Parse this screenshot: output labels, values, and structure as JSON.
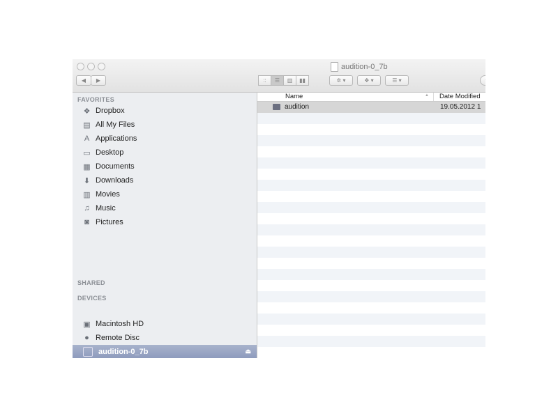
{
  "window": {
    "title": "audition-0_7b"
  },
  "toolbar": {
    "back": "◀",
    "forward": "▶",
    "views": [
      "icon",
      "list",
      "column",
      "coverflow"
    ],
    "action": "✲ ▾",
    "dropbox": "❖ ▾",
    "arrange": "☰ ▾"
  },
  "sidebar": {
    "favorites_label": "FAVORITES",
    "favorites": [
      {
        "label": "Dropbox",
        "icon": "❖"
      },
      {
        "label": "All My Files",
        "icon": "▤"
      },
      {
        "label": "Applications",
        "icon": "A"
      },
      {
        "label": "Desktop",
        "icon": "▭"
      },
      {
        "label": "Documents",
        "icon": "▦"
      },
      {
        "label": "Downloads",
        "icon": "⬇"
      },
      {
        "label": "Movies",
        "icon": "▥"
      },
      {
        "label": "Music",
        "icon": "♫"
      },
      {
        "label": "Pictures",
        "icon": "◙"
      }
    ],
    "shared_label": "SHARED",
    "devices_label": "DEVICES",
    "devices": [
      {
        "label": "Macintosh HD",
        "icon": "▣"
      },
      {
        "label": "Remote Disc",
        "icon": "●"
      }
    ],
    "selected_device": {
      "label": "audition-0_7b",
      "eject": "⏏"
    }
  },
  "list": {
    "columns": {
      "name": "Name",
      "date": "Date Modified",
      "sort": "▲"
    },
    "files": [
      {
        "name": "audition",
        "date": "19.05.2012 1"
      }
    ]
  }
}
